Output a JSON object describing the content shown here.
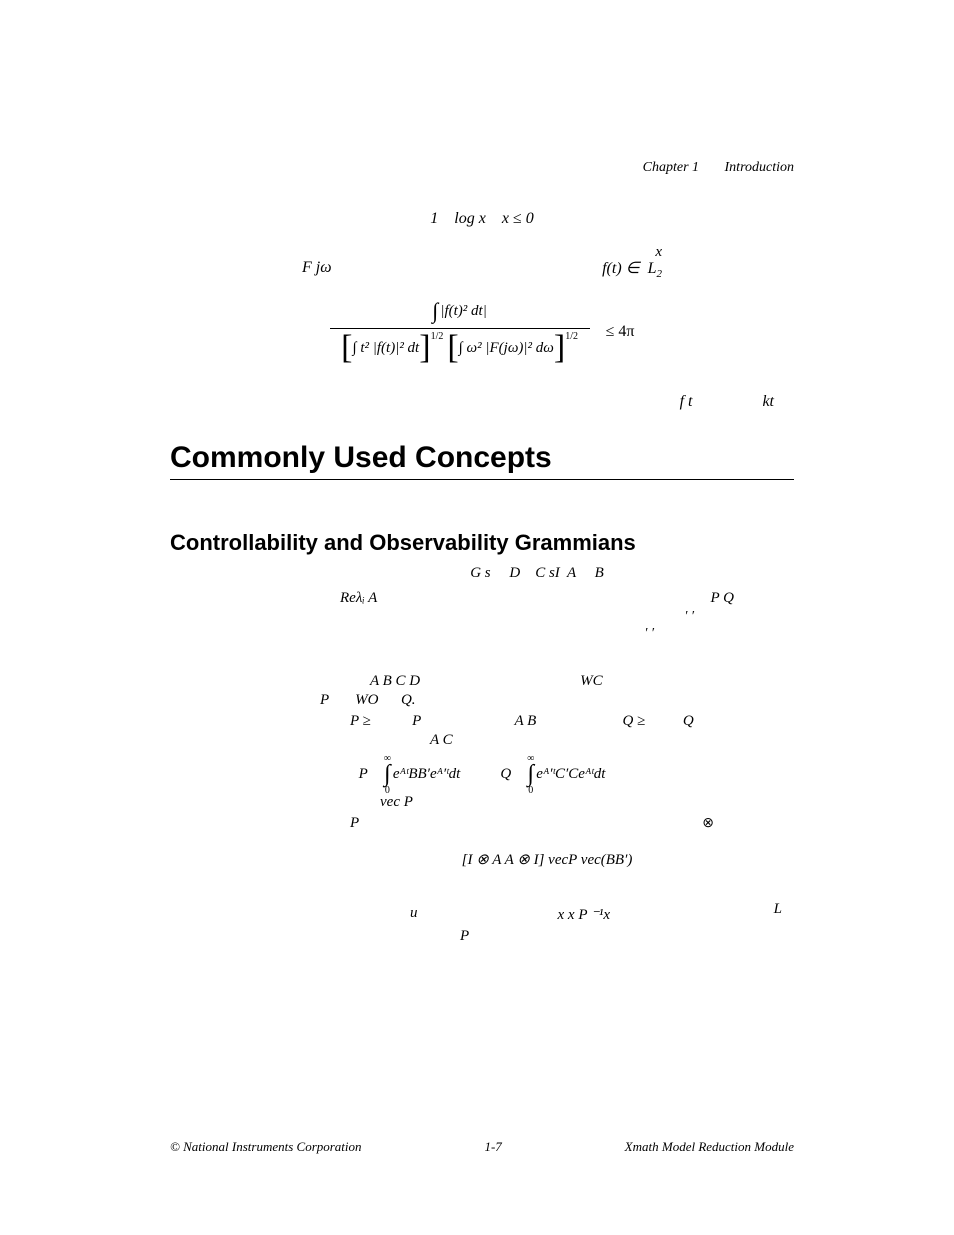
{
  "header": {
    "chapter_label": "Chapter 1",
    "chapter_title": "Introduction"
  },
  "math": {
    "line1": "1    log x    x ≤ 0",
    "fjw": "F jω",
    "l2_super_x": "x",
    "l2_main": "f(t) ∈  L",
    "l2_sub": "2",
    "num_int": "∫",
    "num_body": "|f(t)² dt|",
    "den_group1_inner": "∫ t² |f(t)|² dt",
    "den_half": "1/2",
    "den_group2_inner": "∫ ω² |F(jω)|² dω",
    "ineq": " ≤ 4π",
    "ft": "f t",
    "kt": "kt"
  },
  "sec1": "Commonly Used Concepts",
  "subsec1": "Controllability and Observability Grammians",
  "body": {
    "gs_line": "G s     D    C sI  A     B",
    "re_line": "Reλᵢ A",
    "pq_line": "P  Q",
    "prime1": "′                   ′",
    "prime2": "′          ′",
    "abcd": "A B C D",
    "wc": "WC",
    "pwoQ": "P       WO      Q.",
    "pge": "P ≥           P                         A B                       Q ≥          Q",
    "ac": "A C",
    "p_equals": "P",
    "p_int_body": "eᴬᵗBB′eᴬ′ᵗdt",
    "q_label": "Q",
    "q_int_body": "eᴬ′ᵗC′Ceᴬᵗdt",
    "int_upper": "∞",
    "int_lower": "0",
    "vecP": "vec P",
    "P_alone": "P",
    "kron_sym": "⊗",
    "kron_eq": "[I ⊗ A    A ⊗ I] vecP       vec(BB′)",
    "u": "u",
    "xpx": "x     x  P ⁻¹x",
    "L": "L",
    "P_last": "P"
  },
  "footer": {
    "left": "© National Instruments Corporation",
    "center": "1-7",
    "right": "Xmath Model Reduction Module"
  }
}
